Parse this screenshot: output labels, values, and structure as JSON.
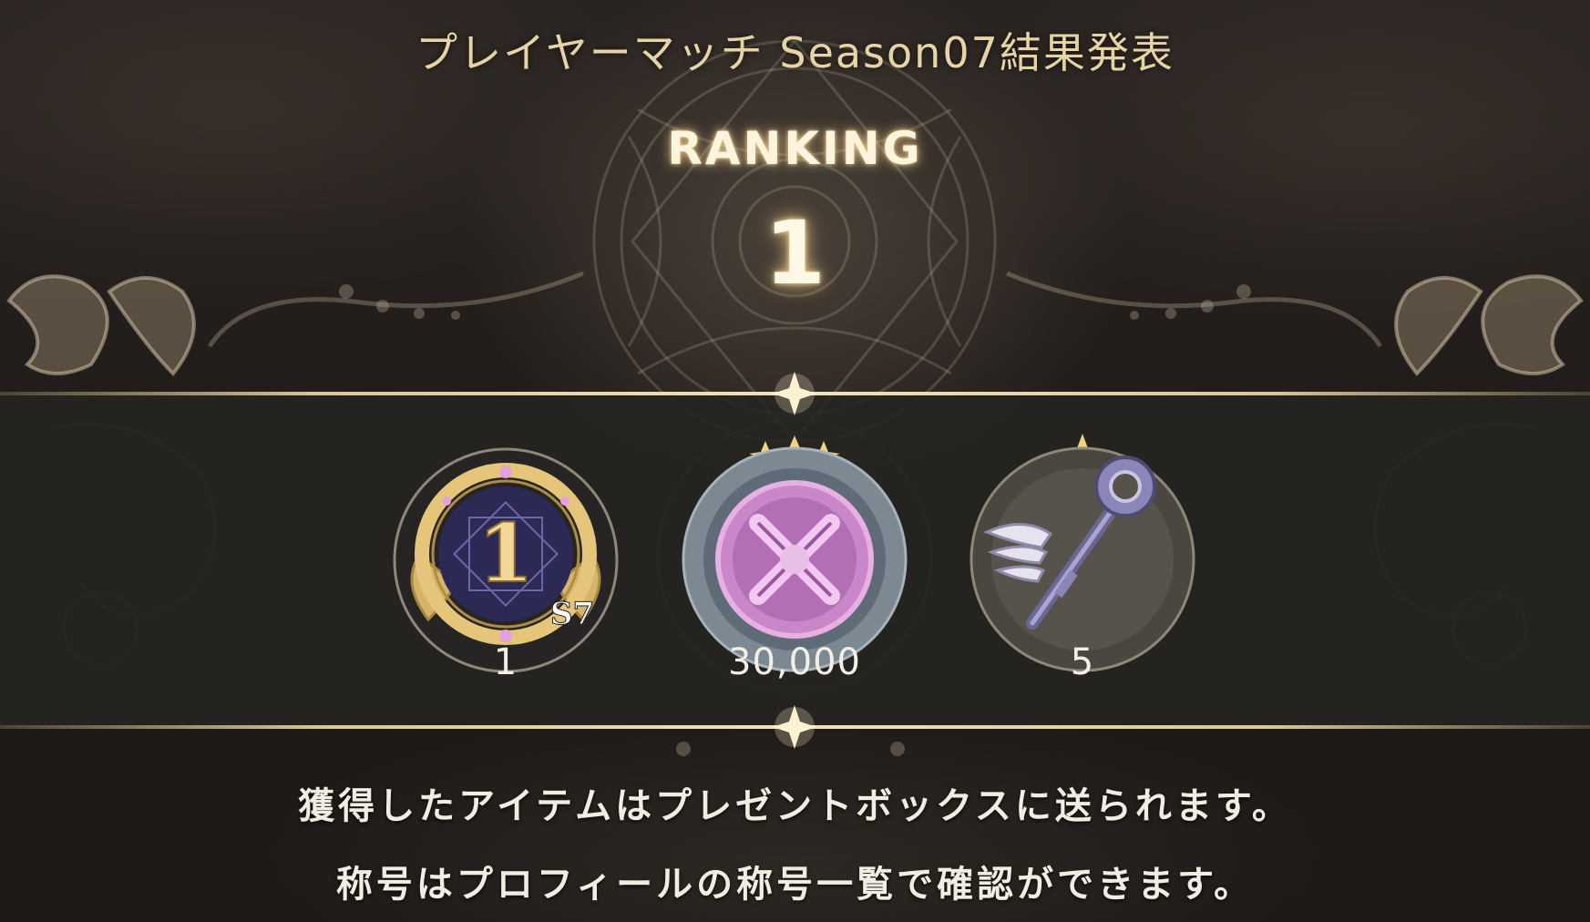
{
  "header": {
    "season_title": "プレイヤーマッチ Season07結果発表",
    "ranking_label": "RANKING",
    "rank_value": "1"
  },
  "rewards": [
    {
      "icon": "title-badge-icon",
      "badge_text": "1",
      "season_tag": "S7",
      "quantity": "1",
      "stars": 0
    },
    {
      "icon": "medal-coin-icon",
      "quantity": "30,000",
      "stars": 3
    },
    {
      "icon": "winged-key-icon",
      "quantity": "5",
      "stars": 1
    }
  ],
  "footer": {
    "line1": "獲得したアイテムはプレゼントボックスに送られます。",
    "line2": "称号はプロフィールの称号一覧で確認ができます。"
  },
  "colors": {
    "gold": "#e6d3a6",
    "band": "#262421",
    "coin_pink": "#c887c8",
    "key_purple": "#8a86b8"
  }
}
